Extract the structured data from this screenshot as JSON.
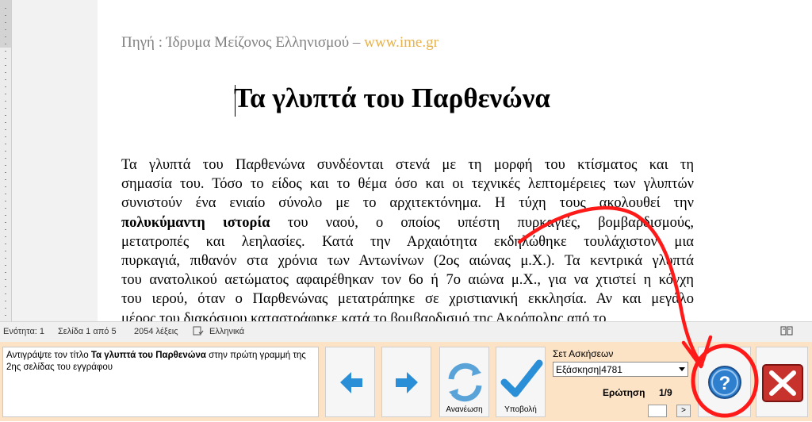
{
  "document": {
    "source_prefix": "Πηγή : Ίδρυμα Μείζονος Ελληνισμού – ",
    "source_link": "www.ime.gr",
    "title": "Τα γλυπτά του Παρθενώνα",
    "body_lines": [
      "Τα γλυπτά του Παρθενώνα συνδέονται στενά με τη μορφή του κτίσματος και τη",
      "σημασία του. Τόσο το είδος και το θέμα όσο και οι τεχνικές λεπτομέρειες των γλυπτών",
      "συνιστούν ένα ενιαίο σύνολο με το αρχιτεκτόνημα. Η τύχη τους ακολουθεί την",
      "του ναού, ο οποίος υπέστη πυρκαγιές, βομβαρδισμούς,",
      "μετατροπές και λεηλασίες. Κατά την Αρχαιότητα εκδηλώθηκε τουλάχιστον μια",
      "πυρκαγιά, πιθανόν στα χρόνια των Αντωνίνων (2ος αιώνας μ.Χ.). Τα κεντρικά γλυπτά",
      "του ανατολικού αετώματος αφαιρέθηκαν τον 6ο ή 7ο αιώνα μ.Χ., για να χτιστεί η κόγχη",
      "του ιερού, όταν ο Παρθενώνας μετατράπηκε σε χριστιανική εκκλησία. Αν και μεγάλο",
      "μέρος του διακόσμου καταστράφηκε κατά το βομβαρδισμό της Ακρόπολης από το"
    ],
    "bold_phrase": "πολυκύμαντη ιστορία"
  },
  "statusbar": {
    "section": "Ενότητα: 1",
    "page": "Σελίδα 1 από 5",
    "words": "2054 λέξεις",
    "language": "Ελληνικά"
  },
  "panel": {
    "instruction_prefix": "Αντιγράψτε τον τίτλο ",
    "instruction_bold": "Τα γλυπτά του Παρθενώνα",
    "instruction_suffix": " στην πρώτη γραμμή της 2ης σελίδας του εγγράφου",
    "refresh_label": "Ανανέωση",
    "submit_label": "Υποβολή",
    "exercise_set_label": "Σετ Ασκήσεων",
    "exercise_selected": "Εξάσκηση|4781",
    "question_label": "Ερώτηση",
    "question_value": "1/9",
    "go_label": ">"
  },
  "colors": {
    "panel_bg": "#fde3c6",
    "link": "#e8b24a",
    "arrow_blue": "#2a8fd6",
    "annotation_red": "#ff1a1a",
    "close_red": "#c8322c"
  },
  "icons": [
    "arrow-left-icon",
    "arrow-right-icon",
    "refresh-icon",
    "checkmark-icon",
    "help-icon",
    "close-icon",
    "read-mode-icon",
    "proofing-icon"
  ]
}
